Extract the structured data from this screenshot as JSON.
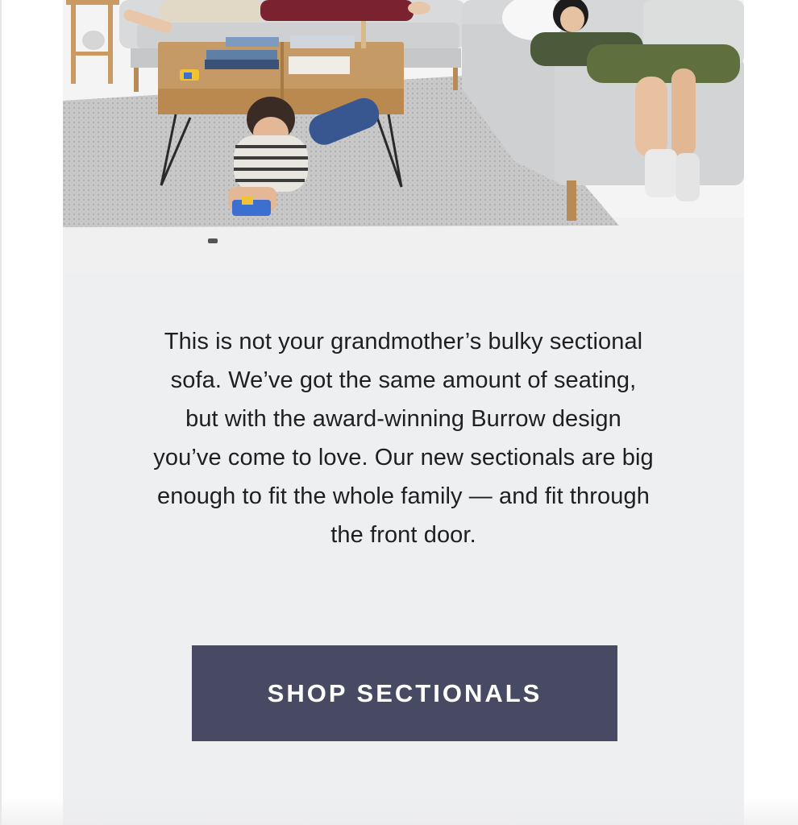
{
  "hero": {
    "scene": "family-living-room-photo"
  },
  "content": {
    "body_text": "This is not your grandmother’s bulky sectional sofa. We’ve got the same amount of seating, but with the award-winning Burrow design you’ve come to love. Our new sectionals are big enough to fit the whole family — and fit through the front door.",
    "cta_label": "SHOP SECTIONALS"
  },
  "colors": {
    "page_background": "#ffffff",
    "panel_background": "#eeeff1",
    "cta_background": "#484a63",
    "cta_text": "#ffffff",
    "body_text": "#1f1f22"
  }
}
